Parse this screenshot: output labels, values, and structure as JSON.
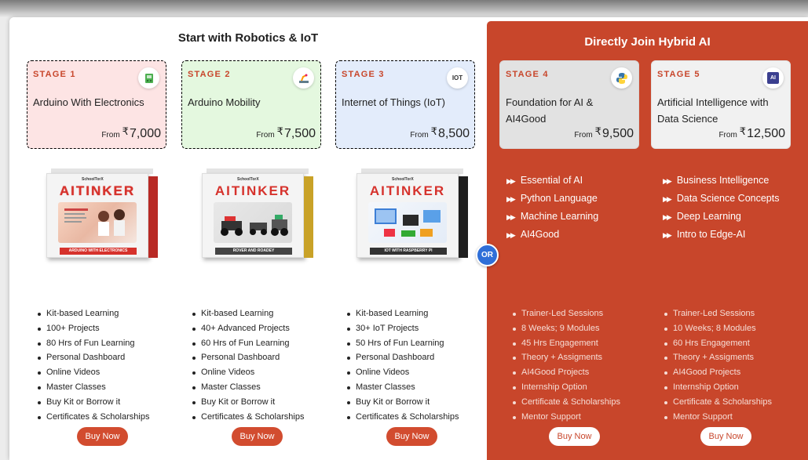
{
  "left_section": {
    "title": "Start with Robotics & IoT"
  },
  "right_section": {
    "title": "Directly Join Hybrid AI"
  },
  "or_label": "OR",
  "currency": "₹",
  "from_label": "From",
  "stages": [
    {
      "stage": "STAGE 1",
      "title": "Arduino With Electronics",
      "price": "7,000",
      "icon": "electronics-icon",
      "box_brand": "SchoolTorX",
      "box_logo_a": "AI",
      "box_logo_b": "TINKER",
      "box_caption": "ARDUINO WITH ELECTRONICS",
      "color": "#d6322c",
      "features": [
        "Kit-based Learning",
        "100+ Projects",
        "80 Hrs of Fun Learning",
        "Personal Dashboard",
        "Online Videos",
        "Master Classes",
        "Buy Kit or Borrow it",
        "Certificates & Scholarships"
      ],
      "buy_label": "Buy Now"
    },
    {
      "stage": "STAGE 2",
      "title": "Arduino Mobility",
      "price": "7,500",
      "icon": "robot-arm-icon",
      "box_brand": "SchoolTorX",
      "box_logo_a": "AI",
      "box_logo_b": "TINKER",
      "box_caption": "ROVER AND ROADEY",
      "color": "#c9a227",
      "features": [
        "Kit-based Learning",
        "40+ Advanced Projects",
        "60 Hrs of Fun Learning",
        "Personal Dashboard",
        "Online Videos",
        "Master Classes",
        "Buy Kit or Borrow it",
        "Certificates & Scholarships"
      ],
      "buy_label": "Buy Now"
    },
    {
      "stage": "STAGE 3",
      "title": "Internet of Things (IoT)",
      "price": "8,500",
      "icon": "iot-icon",
      "icon_text": "IOT",
      "box_brand": "SchoolTorX",
      "box_logo_a": "AI",
      "box_logo_b": "TINKER",
      "box_caption": "IOT WITH RASPBERRY PI",
      "color": "#2b2b2b",
      "features": [
        "Kit-based Learning",
        "30+ IoT Projects",
        "50 Hrs of Fun Learning",
        "Personal Dashboard",
        "Online Videos",
        "Master Classes",
        "Buy Kit or Borrow it",
        "Certificates & Scholarships"
      ],
      "buy_label": "Buy Now"
    },
    {
      "stage": "STAGE 4",
      "title": "Foundation for AI & AI4Good",
      "price": "9,500",
      "icon": "python-icon",
      "topics": [
        "Essential of AI",
        "Python Language",
        "Machine Learning",
        "AI4Good"
      ],
      "features": [
        "Trainer-Led Sessions",
        "8 Weeks; 9 Modules",
        "45 Hrs Engagement",
        "Theory + Assigments",
        "AI4Good Projects",
        "Internship Option",
        "Certificate & Scholarships",
        "Mentor Support"
      ],
      "buy_label": "Buy Now"
    },
    {
      "stage": "STAGE 5",
      "title": "Artificial Intelligence with Data Science",
      "price": "12,500",
      "icon": "ai-chip-icon",
      "icon_text": "AI",
      "topics": [
        "Business Intelligence",
        "Data Science Concepts",
        "Deep Learning",
        "Intro to Edge-AI"
      ],
      "features": [
        "Trainer-Led Sessions",
        "10 Weeks; 8 Modules",
        "60 Hrs Engagement",
        "Theory + Assigments",
        "AI4Good Projects",
        "Internship Option",
        "Certificate & Scholarships",
        "Mentor Support"
      ],
      "buy_label": "Buy Now"
    }
  ],
  "colors": {
    "accent": "#c8462b",
    "or_badge": "#2f6fd8"
  }
}
